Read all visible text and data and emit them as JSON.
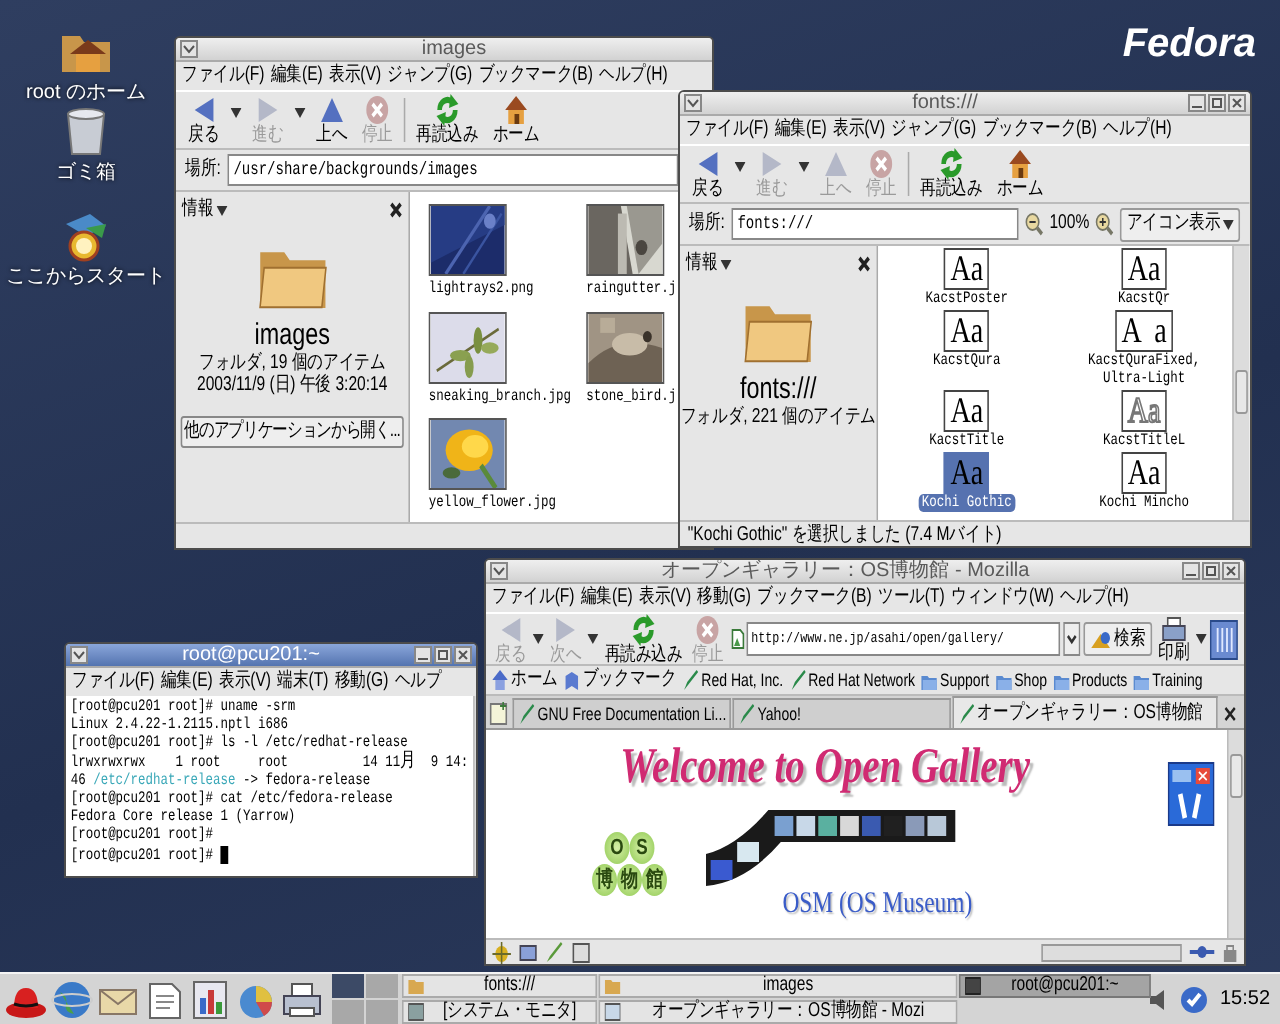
{
  "desktop": {
    "logo": "Fedora",
    "icons": [
      {
        "label": "root のホーム",
        "kind": "home"
      },
      {
        "label": "ゴミ箱",
        "kind": "trash"
      },
      {
        "label": "ここからスタート",
        "kind": "start"
      }
    ]
  },
  "images_window": {
    "title": "images",
    "menu": [
      "ファイル(F)",
      "編集(E)",
      "表示(V)",
      "ジャンプ(G)",
      "ブックマーク(B)",
      "ヘルプ(H)"
    ],
    "toolbar": [
      {
        "label": "戻る",
        "kind": "back",
        "disabled": false
      },
      {
        "label": "進む",
        "kind": "forward",
        "disabled": true
      },
      {
        "label": "上へ",
        "kind": "up",
        "disabled": false
      },
      {
        "label": "停止",
        "kind": "stop",
        "disabled": true
      },
      {
        "label": "再読込み",
        "kind": "reload",
        "disabled": false
      },
      {
        "label": "ホーム",
        "kind": "home",
        "disabled": false
      }
    ],
    "location_label": "場所:",
    "location": "/usr/share/backgrounds/images",
    "sidebar": {
      "header": "情報",
      "name": "images",
      "details": [
        "フォルダ, 19 個のアイテム",
        "2003/11/9 (日) 午後 3:20:14"
      ],
      "button": "他のアプリケーションから開く..."
    },
    "items": [
      {
        "label": "lightrays2.png"
      },
      {
        "label": "raingutter.j"
      },
      {
        "label": "sneaking_branch.jpg"
      },
      {
        "label": "stone_bird.j"
      },
      {
        "label": "yellow_flower.jpg"
      }
    ]
  },
  "fonts_window": {
    "title": "fonts:///",
    "menu": [
      "ファイル(F)",
      "編集(E)",
      "表示(V)",
      "ジャンプ(G)",
      "ブックマーク(B)",
      "ヘルプ(H)"
    ],
    "toolbar": [
      {
        "label": "戻る",
        "kind": "back",
        "disabled": false
      },
      {
        "label": "進む",
        "kind": "forward",
        "disabled": true
      },
      {
        "label": "上へ",
        "kind": "up",
        "disabled": true
      },
      {
        "label": "停止",
        "kind": "stop",
        "disabled": true
      },
      {
        "label": "再読込み",
        "kind": "reload",
        "disabled": false
      },
      {
        "label": "ホーム",
        "kind": "home",
        "disabled": false
      }
    ],
    "location_label": "場所:",
    "location": "fonts:///",
    "zoom": "100%",
    "view": "アイコン表示",
    "sidebar": {
      "header": "情報",
      "name": "fonts:///",
      "details": [
        "フォルダ, 221 個のアイテム"
      ]
    },
    "items": [
      {
        "label": "KacstPoster",
        "sample": "Aa",
        "outline": false,
        "selected": false
      },
      {
        "label": "KacstQr",
        "sample": "Aa",
        "outline": false,
        "selected": false
      },
      {
        "label": "KacstQura",
        "sample": "Aa",
        "outline": false,
        "selected": false
      },
      {
        "label": "KacstQuraFixed, Ultra-Light",
        "sample": "A  a",
        "outline": false,
        "selected": false
      },
      {
        "label": "KacstTitle",
        "sample": "Aa",
        "outline": false,
        "selected": false
      },
      {
        "label": "KacstTitleL",
        "sample": "Aa",
        "outline": true,
        "selected": false
      },
      {
        "label": "Kochi Gothic",
        "sample": "Aa",
        "outline": false,
        "selected": true
      },
      {
        "label": "Kochi Mincho",
        "sample": "Aa",
        "outline": false,
        "selected": false
      }
    ],
    "status": "\"Kochi Gothic\" を選択しました (7.4 Mバイト)"
  },
  "browser": {
    "title": "オープンギャラリー：OS博物館 - Mozilla",
    "menu": [
      "ファイル(F)",
      "編集(E)",
      "表示(V)",
      "移動(G)",
      "ブックマーク(B)",
      "ツール(T)",
      "ウィンドウ(W)",
      "ヘルプ(H)"
    ],
    "nav": [
      {
        "label": "戻る",
        "kind": "back",
        "disabled": true
      },
      {
        "label": "次へ",
        "kind": "forward",
        "disabled": true
      },
      {
        "label": "再読み込み",
        "kind": "reload",
        "disabled": false
      },
      {
        "label": "停止",
        "kind": "stop",
        "disabled": true
      }
    ],
    "url": "http://www.ne.jp/asahi/open/gallery/",
    "search": "検索",
    "print": "印刷",
    "bookmarks": [
      {
        "label": "ホーム",
        "kind": "home"
      },
      {
        "label": "ブックマーク",
        "kind": "bookmarks"
      },
      {
        "label": "Red Hat, Inc.",
        "kind": "link"
      },
      {
        "label": "Red Hat Network",
        "kind": "link"
      },
      {
        "label": "Support",
        "kind": "folder"
      },
      {
        "label": "Shop",
        "kind": "folder"
      },
      {
        "label": "Products",
        "kind": "folder"
      },
      {
        "label": "Training",
        "kind": "folder"
      }
    ],
    "tabs": [
      {
        "label": "GNU Free Documentation Li...",
        "selected": false
      },
      {
        "label": "Yahoo!",
        "selected": false
      },
      {
        "label": "オープンギャラリー：OS博物館",
        "selected": true
      }
    ],
    "page": {
      "heading": "Welcome to Open Gallery",
      "logo_top": [
        "O",
        "S"
      ],
      "logo_bottom": [
        "博",
        "物",
        "館"
      ],
      "caption": "OSM (OS Museum)"
    }
  },
  "terminal": {
    "title": "root@pcu201:~",
    "menu": [
      "ファイル(F)",
      "編集(E)",
      "表示(V)",
      "端末(T)",
      "移動(G)",
      "ヘルプ"
    ],
    "lines": [
      {
        "text": "[root@pcu201 root]# uname -srm"
      },
      {
        "text": "Linux 2.4.22-1.2115.nptl i686"
      },
      {
        "text": "[root@pcu201 root]# ls -l /etc/redhat-release"
      },
      {
        "text": "lrwxrwxrwx    1 root     root          14 11月  9 14:"
      },
      {
        "parts": [
          {
            "text": "46 ",
            "kind": "plain"
          },
          {
            "text": "/etc/redhat-release",
            "kind": "link"
          },
          {
            "text": " -> fedora-release",
            "kind": "plain"
          }
        ]
      },
      {
        "text": "[root@pcu201 root]# cat /etc/fedora-release"
      },
      {
        "text": "Fedora Core release 1 (Yarrow)"
      },
      {
        "text": "[root@pcu201 root]#"
      },
      {
        "text": "[root@pcu201 root]# "
      }
    ],
    "cursor": true
  },
  "taskbar": {
    "launchers": [
      {
        "kind": "hat"
      },
      {
        "kind": "globe"
      },
      {
        "kind": "mail"
      },
      {
        "kind": "document"
      },
      {
        "kind": "chart"
      },
      {
        "kind": "disc"
      },
      {
        "kind": "printer"
      }
    ],
    "workspaces": [
      {
        "selected": true
      },
      {
        "selected": false
      },
      {
        "selected": false
      },
      {
        "selected": false
      }
    ],
    "tasks": [
      {
        "label": "fonts:///",
        "kind": "folder",
        "selected": false
      },
      {
        "label": "images",
        "kind": "folder",
        "selected": false
      },
      {
        "label": "root@pcu201:~",
        "kind": "terminal",
        "selected": true
      },
      {
        "label": "[システム・モニタ]",
        "kind": "monitor",
        "selected": false
      },
      {
        "label": "オープンギャラリー：OS博物館 - Mozi",
        "kind": "browser",
        "selected": false
      }
    ],
    "clock": "15:52"
  }
}
